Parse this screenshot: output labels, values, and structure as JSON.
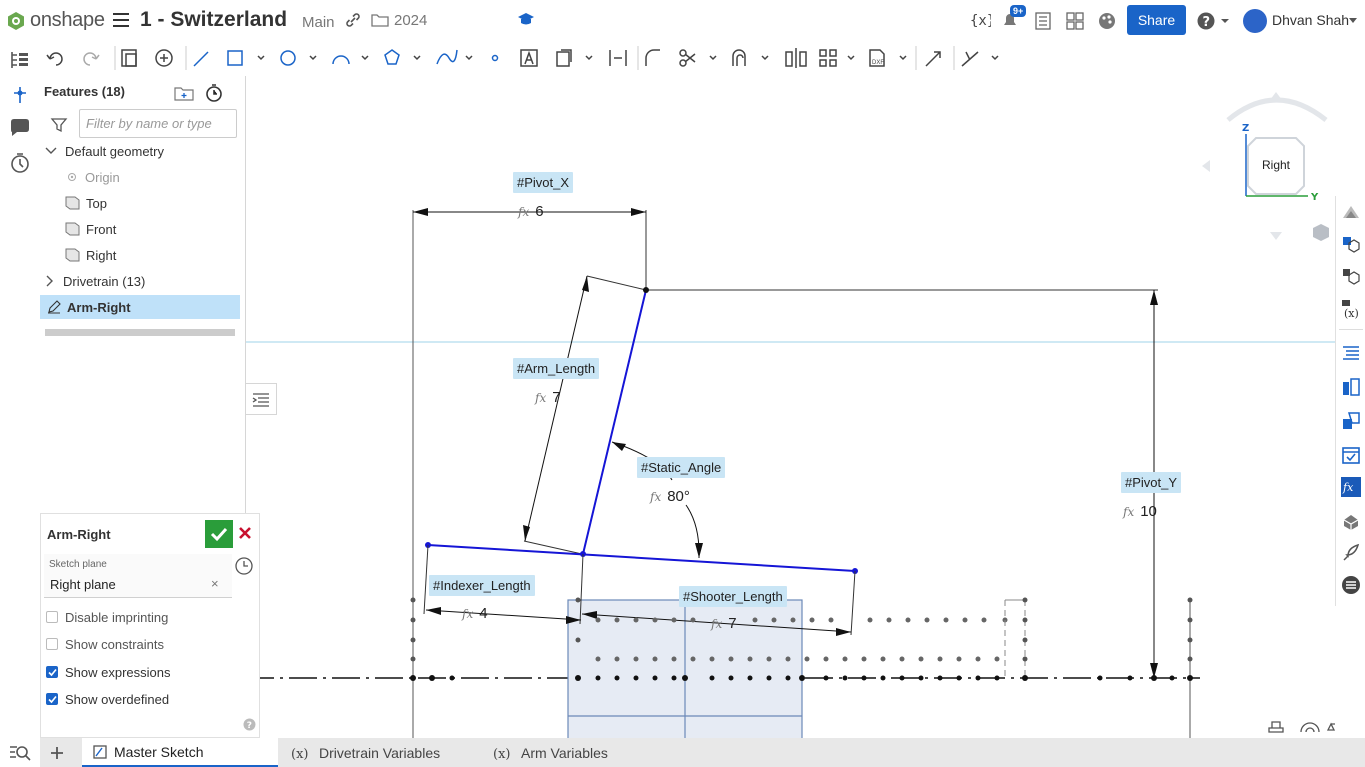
{
  "app": {
    "logo_text": "onshape",
    "doc_title": "1 - Switzerland",
    "branch": "Main",
    "folder": "2024"
  },
  "header": {
    "notif_badge": "9+",
    "share_label": "Share",
    "user_name": "Dhvan Shah"
  },
  "features": {
    "title": "Features (18)",
    "filter_placeholder": "Filter by name or type",
    "items": [
      {
        "label": "Default geometry"
      },
      {
        "label": "Origin"
      },
      {
        "label": "Top"
      },
      {
        "label": "Front"
      },
      {
        "label": "Right"
      },
      {
        "label": "Drivetrain (13)"
      },
      {
        "label": "Arm-Right"
      }
    ]
  },
  "sketch_panel": {
    "title": "Arm-Right",
    "plane_label": "Sketch plane",
    "plane_value": "Right plane",
    "options": [
      {
        "label": "Disable imprinting",
        "checked": false
      },
      {
        "label": "Show constraints",
        "checked": false
      },
      {
        "label": "Show expressions",
        "checked": true
      },
      {
        "label": "Show overdefined",
        "checked": true
      }
    ]
  },
  "dimensions": {
    "pivot_x": {
      "name": "#Pivot_X",
      "value": "6"
    },
    "arm_length": {
      "name": "#Arm_Length",
      "value": "7"
    },
    "static_angle": {
      "name": "#Static_Angle",
      "value": "80°"
    },
    "pivot_y": {
      "name": "#Pivot_Y",
      "value": "10"
    },
    "indexer_length": {
      "name": "#Indexer_Length",
      "value": "4"
    },
    "shooter_length": {
      "name": "#Shooter_Length",
      "value": "7"
    }
  },
  "view_cube": {
    "face_label": "Right",
    "axis_z": "Z",
    "axis_y": "Y"
  },
  "tabs": [
    {
      "label": "Master Sketch",
      "active": true
    },
    {
      "label": "Drivetrain Variables",
      "active": false
    },
    {
      "label": "Arm Variables",
      "active": false
    }
  ],
  "colors": {
    "accent": "#1a64c8",
    "sketch_blue": "#1515d6",
    "dim_label_bg": "#c9e5f5",
    "selected_row": "#bfe1f9",
    "confirm": "#2a9d3a"
  }
}
